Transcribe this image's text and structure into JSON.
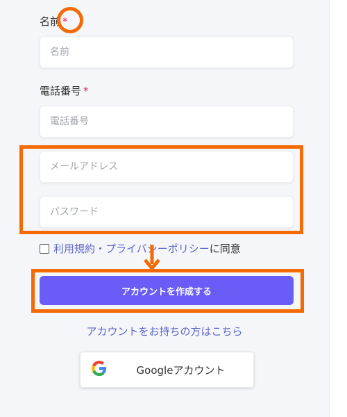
{
  "form": {
    "name": {
      "label": "名前",
      "required_mark": "*",
      "placeholder": "名前"
    },
    "phone": {
      "label": "電話番号",
      "required_mark": "*",
      "placeholder": "電話番号"
    },
    "email": {
      "placeholder": "メールアドレス"
    },
    "password": {
      "placeholder": "パスワード"
    },
    "terms": {
      "link_text": "利用規約・プライバシーポリシー",
      "suffix": "に同意",
      "checked": false
    },
    "submit_label": "アカウントを作成する",
    "login_link": "アカウントをお持ちの方はこちら",
    "google_button": {
      "icon": "google-g-icon",
      "label": "Googleアカウント"
    }
  },
  "colors": {
    "accent": "#6a5cf6",
    "link": "#5b67c9",
    "required": "#e0245e",
    "annotation": "#f46a04"
  }
}
